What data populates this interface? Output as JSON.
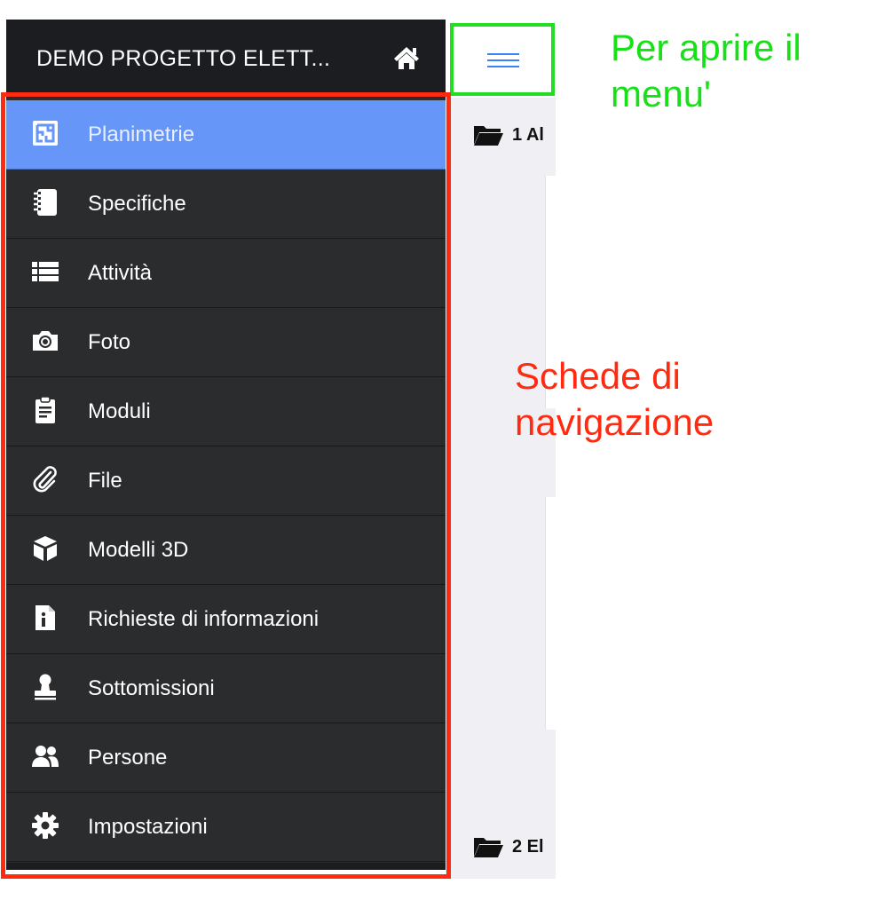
{
  "header": {
    "project_title": "DEMO PROGETTO ELETT...",
    "home_icon": "home-icon",
    "menu_icon": "hamburger-icon"
  },
  "nav": {
    "items": [
      {
        "label": "Planimetrie",
        "icon": "floorplan-icon",
        "active": true
      },
      {
        "label": "Specifiche",
        "icon": "notebook-icon",
        "active": false
      },
      {
        "label": "Attività",
        "icon": "list-icon",
        "active": false
      },
      {
        "label": "Foto",
        "icon": "camera-icon",
        "active": false
      },
      {
        "label": "Moduli",
        "icon": "clipboard-icon",
        "active": false
      },
      {
        "label": "File",
        "icon": "paperclip-icon",
        "active": false
      },
      {
        "label": "Modelli 3D",
        "icon": "cube-icon",
        "active": false
      },
      {
        "label": "Richieste di informazioni",
        "icon": "info-file-icon",
        "active": false
      },
      {
        "label": "Sottomissioni",
        "icon": "stamp-icon",
        "active": false
      },
      {
        "label": "Persone",
        "icon": "people-icon",
        "active": false
      },
      {
        "label": "Impostazioni",
        "icon": "gear-icon",
        "active": false
      }
    ]
  },
  "content": {
    "folders": [
      {
        "label": "1 Al",
        "icon": "folder-icon"
      },
      {
        "label": "2 El",
        "icon": "folder-icon"
      }
    ]
  },
  "annotations": {
    "menu_note": "Per aprire il menu'",
    "nav_note": "Schede di navigazione"
  },
  "colors": {
    "active_item": "#6596f8",
    "drawer_bg": "#2b2c2e",
    "header_bg": "#1b1d21",
    "menu_annotation": "#22dd22",
    "nav_annotation": "#ff2a10",
    "hamburger": "#3b82f6"
  }
}
